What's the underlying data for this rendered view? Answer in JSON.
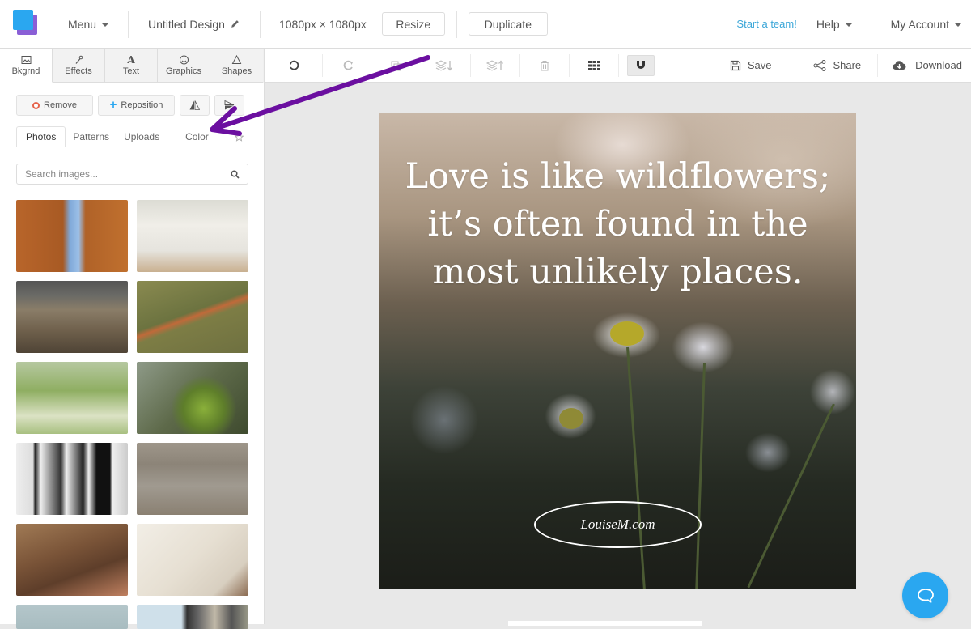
{
  "header": {
    "menu_label": "Menu",
    "design_title": "Untitled Design",
    "dimensions": "1080px × 1080px",
    "resize_label": "Resize",
    "duplicate_label": "Duplicate",
    "start_team_label": "Start a team!",
    "help_label": "Help",
    "account_label": "My Account"
  },
  "side_tabs": [
    {
      "label": "Bkgrnd",
      "icon": "image-icon",
      "active": true
    },
    {
      "label": "Effects",
      "icon": "magic-wand-icon"
    },
    {
      "label": "Text",
      "icon": "text-icon"
    },
    {
      "label": "Graphics",
      "icon": "smiley-icon"
    },
    {
      "label": "Shapes",
      "icon": "triangle-icon"
    }
  ],
  "toolbar": {
    "tools": [
      "undo-icon",
      "redo-icon",
      "copy-icon",
      "layer-down-icon",
      "layer-up-icon",
      "trash-icon",
      "grid-icon",
      "magnet-icon"
    ],
    "save_label": "Save",
    "share_label": "Share",
    "download_label": "Download"
  },
  "panel": {
    "remove_label": "Remove",
    "reposition_label": "Reposition",
    "flip_icon": "flip-horizontal-icon",
    "flip_v_icon": "flip-vertical-icon",
    "subtabs": [
      "Photos",
      "Patterns",
      "Uploads",
      "Color"
    ],
    "active_subtab": "Photos",
    "search_placeholder": "Search images...",
    "photos": [
      {
        "desc": "rock arch with blue sky",
        "color": "#b8652a"
      },
      {
        "desc": "three graduates from behind",
        "color": "#e8e6e0"
      },
      {
        "desc": "hiker on moorland",
        "color": "#6a6050"
      },
      {
        "desc": "winding dirt trail on hillside",
        "color": "#7d7d45"
      },
      {
        "desc": "woman in flower meadow",
        "color": "#8aa860"
      },
      {
        "desc": "aerial green trees",
        "color": "#6a7a4a"
      },
      {
        "desc": "white french doors",
        "color": "#d8d8d8"
      },
      {
        "desc": "ocean waves on beach",
        "color": "#8f8679"
      },
      {
        "desc": "tea set on wooden tray",
        "color": "#8a6445"
      },
      {
        "desc": "white cozy interior",
        "color": "#e8e2d8"
      },
      {
        "desc": "pale blue sky",
        "color": "#a8bcc0"
      },
      {
        "desc": "striped building facade",
        "color": "#9aa4aa"
      }
    ]
  },
  "canvas": {
    "quote_lines": [
      "Love is like wildflowers;",
      "it’s often found in the",
      "most unlikely places."
    ],
    "watermark": "LouiseM.com"
  },
  "annotation": {
    "arrow_color": "#6b0fa0"
  },
  "chat_button": "chat-icon"
}
